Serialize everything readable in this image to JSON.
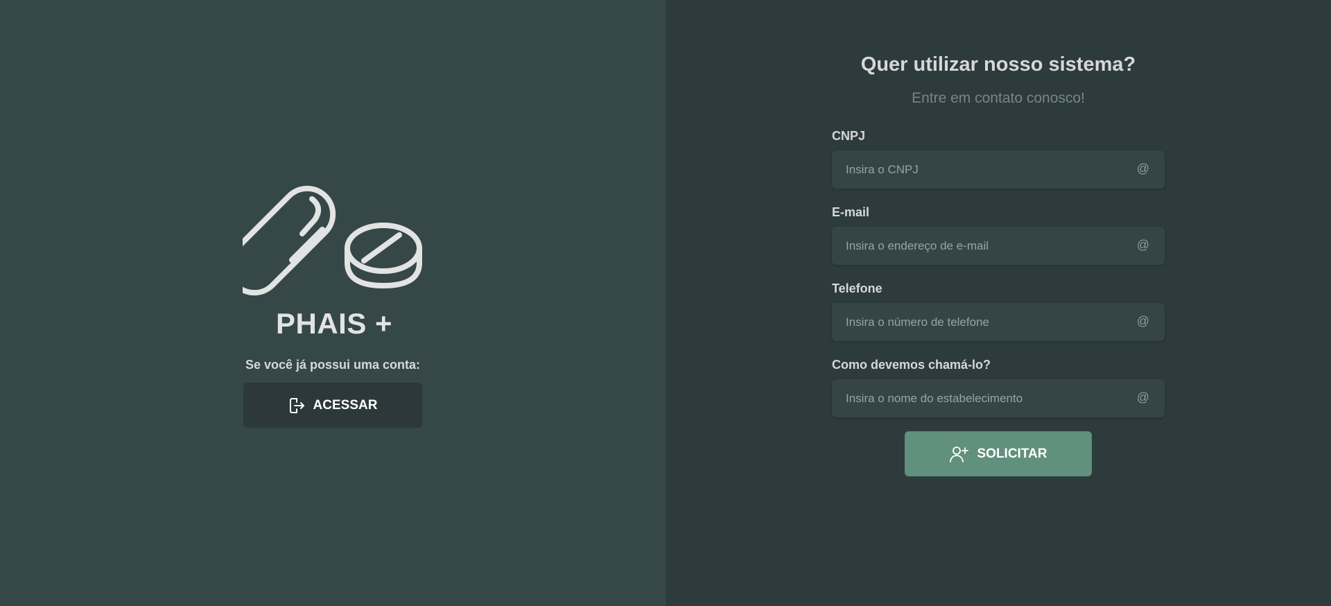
{
  "brand": {
    "name": "PHAIS +",
    "logo_icon": "pills-icon"
  },
  "login": {
    "prompt": "Se você já possui uma conta:",
    "button_label": "ACESSAR",
    "button_icon": "sign-in-icon"
  },
  "contact_form": {
    "title": "Quer utilizar nosso sistema?",
    "subtitle": "Entre em contato conosco!",
    "fields": [
      {
        "label": "CNPJ",
        "placeholder": "Insira o CNPJ",
        "value": "",
        "icon": "at-icon",
        "icon_glyph": "@"
      },
      {
        "label": "E-mail",
        "placeholder": "Insira o endereço de e-mail",
        "value": "",
        "icon": "at-icon",
        "icon_glyph": "@"
      },
      {
        "label": "Telefone",
        "placeholder": "Insira o número de telefone",
        "value": "",
        "icon": "at-icon",
        "icon_glyph": "@"
      },
      {
        "label": "Como devemos chamá-lo?",
        "placeholder": "Insira o nome do estabelecimento",
        "value": "",
        "icon": "at-icon",
        "icon_glyph": "@"
      }
    ],
    "submit_label": "SOLICITAR",
    "submit_icon": "user-plus-icon"
  },
  "colors": {
    "left_panel": "#364747",
    "right_panel": "#2d3b3c",
    "input_bg": "#354546",
    "access_button": "#2c3839",
    "submit_button": "#62907e",
    "text_light": "#d6d8d8",
    "subtitle": "#768686"
  }
}
